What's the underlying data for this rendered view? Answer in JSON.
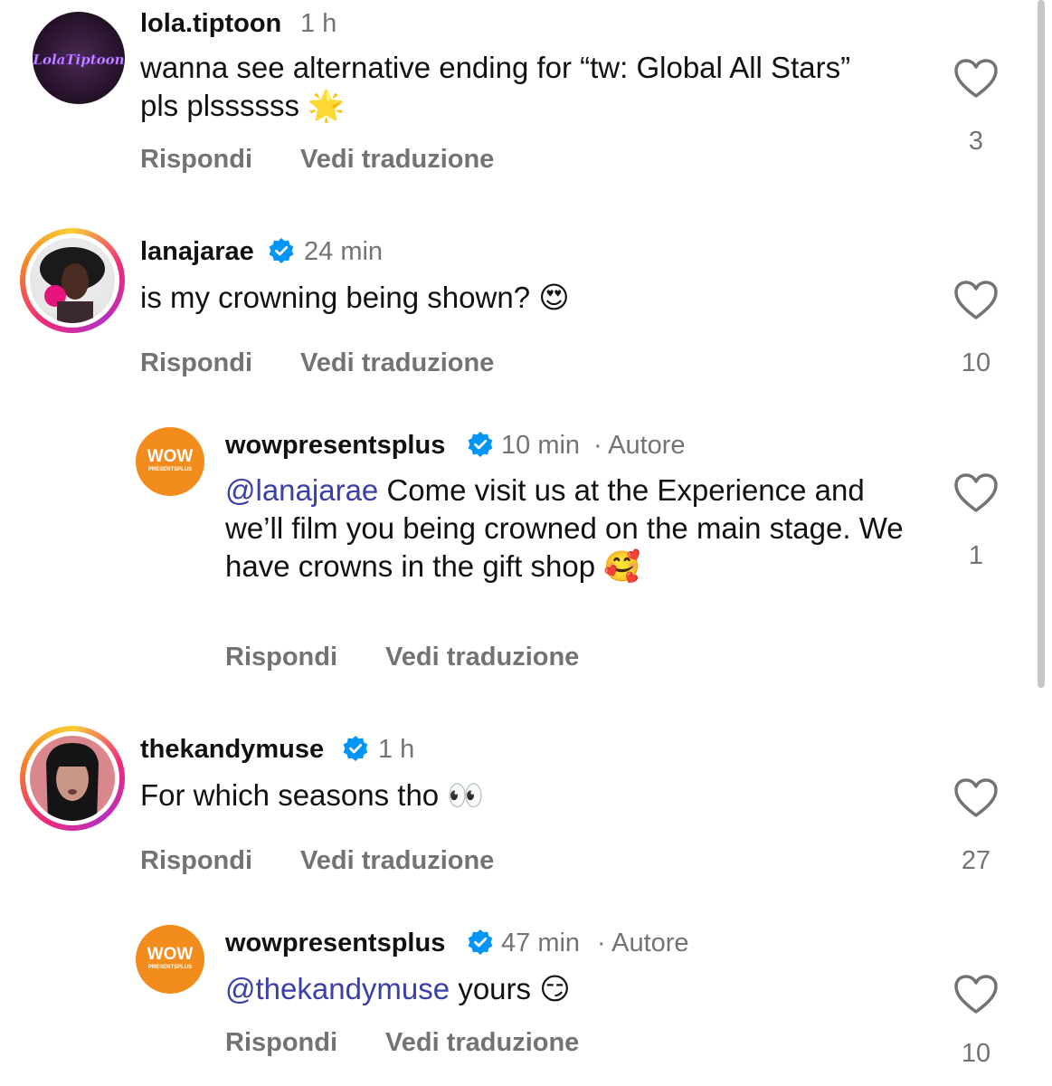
{
  "actions": {
    "reply": "Rispondi",
    "translate": "Vedi traduzione"
  },
  "comments": [
    {
      "username": "lola.tiptoon",
      "time": "1 h",
      "verified": false,
      "avatar_text": "LolaTiptoon",
      "text": "wanna see alternative ending for “tw: Global All Stars” pls plssssss",
      "emoji": "🌟",
      "likes": "3"
    },
    {
      "username": "lanajarae",
      "time": "24 min",
      "verified": true,
      "text": "is my crowning being shown?",
      "emoji": "😍",
      "likes": "10"
    },
    {
      "username": "wowpresentsplus",
      "time": "10 min",
      "author_tag": "· Autore",
      "verified": true,
      "avatar_text": "WOW",
      "avatar_subtext": "PRESENTSPLUS",
      "mention": "@lanajarae",
      "text": "Come visit us at the Experience and we’ll film you being crowned on the main stage. We have crowns in the gift shop",
      "emoji": "🥰",
      "likes": "1"
    },
    {
      "username": "thekandymuse",
      "time": "1 h",
      "verified": true,
      "text": "For which seasons tho",
      "emoji": "👀",
      "likes": "27"
    },
    {
      "username": "wowpresentsplus",
      "time": "47 min",
      "author_tag": "· Autore",
      "verified": true,
      "avatar_text": "WOW",
      "avatar_subtext": "PRESENTSPLUS",
      "mention": "@thekandymuse",
      "text": "yours",
      "emoji": "😏",
      "likes": "10"
    }
  ],
  "colors": {
    "secondary_text": "#737373",
    "mention": "#3b3fa8",
    "verified": "#0095f6",
    "brand_orange": "#f28c1c"
  }
}
